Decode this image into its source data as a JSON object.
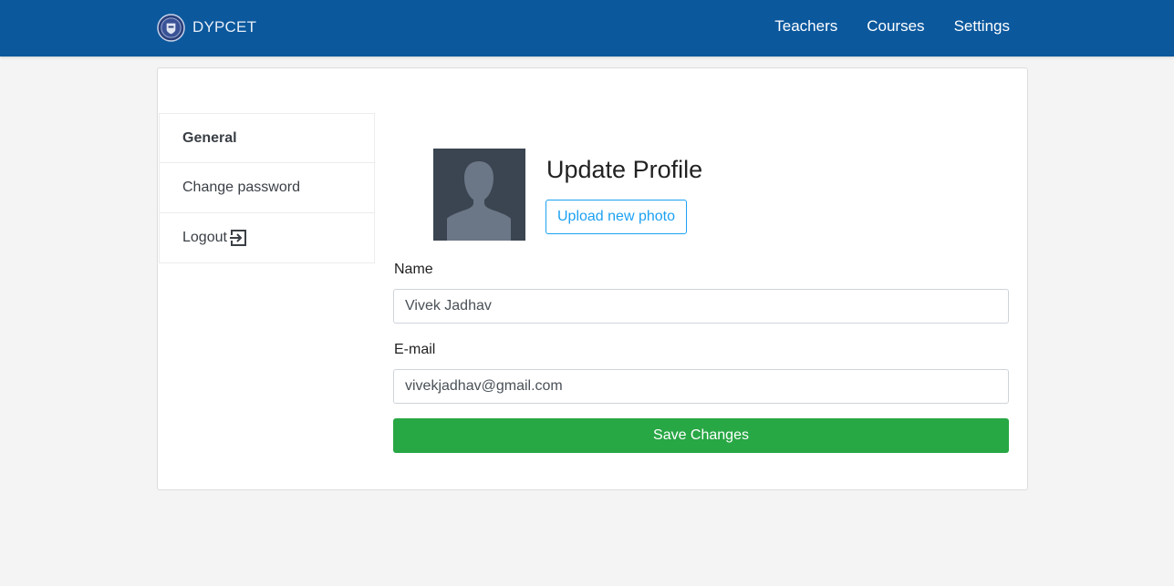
{
  "navbar": {
    "brand": "DYPCET",
    "links": [
      "Teachers",
      "Courses",
      "Settings"
    ],
    "background": "#0b589d"
  },
  "sidebar": {
    "items": [
      {
        "label": "General",
        "active": true
      },
      {
        "label": "Change password",
        "active": false
      },
      {
        "label": "Logout",
        "active": false,
        "icon": "logout-icon"
      }
    ]
  },
  "profile": {
    "title": "Update Profile",
    "upload_label": "Upload new photo",
    "avatar_icon": "user-silhouette-icon"
  },
  "form": {
    "name_label": "Name",
    "name_value": "Vivek Jadhav",
    "email_label": "E-mail",
    "email_value": "vivekjadhav@gmail.com",
    "save_label": "Save Changes"
  },
  "colors": {
    "accent": "#1da1f2",
    "success": "#28a745"
  }
}
